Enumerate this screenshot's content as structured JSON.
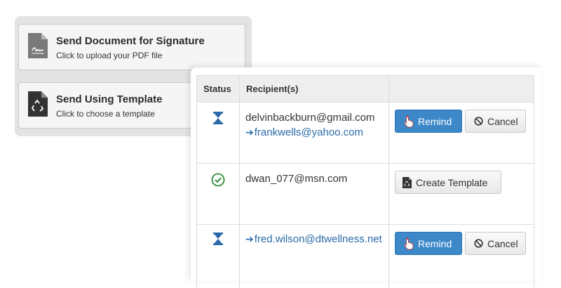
{
  "cards": [
    {
      "title": "Send Document for Signature",
      "subtitle": "Click to upload your PDF file",
      "icon": "signature-document-icon"
    },
    {
      "title": "Send Using Template",
      "subtitle": "Click to choose a template",
      "icon": "template-document-icon"
    }
  ],
  "table": {
    "headers": {
      "status": "Status",
      "recipients": "Recipient(s)",
      "actions": ""
    },
    "rows": [
      {
        "status": "pending",
        "status_icon": "hourglass-icon",
        "recipients": [
          "delvinbackburn@gmail.com",
          "frankwells@yahoo.com"
        ],
        "actions": {
          "remind": "Remind",
          "cancel": "Cancel"
        }
      },
      {
        "status": "completed",
        "status_icon": "check-circle-icon",
        "recipients": [
          "dwan_077@msn.com"
        ],
        "actions": {
          "create_template": "Create Template"
        }
      },
      {
        "status": "pending",
        "status_icon": "hourglass-icon",
        "recipients": [
          "fred.wilson@dtwellness.net"
        ],
        "actions": {
          "remind": "Remind",
          "cancel": "Cancel"
        }
      }
    ]
  },
  "colors": {
    "primary": "#3c88c9",
    "link": "#2a6aa8",
    "success": "#2e8b3a",
    "panel_bg": "#e3e3e3",
    "header_bg": "#eeeeee"
  }
}
